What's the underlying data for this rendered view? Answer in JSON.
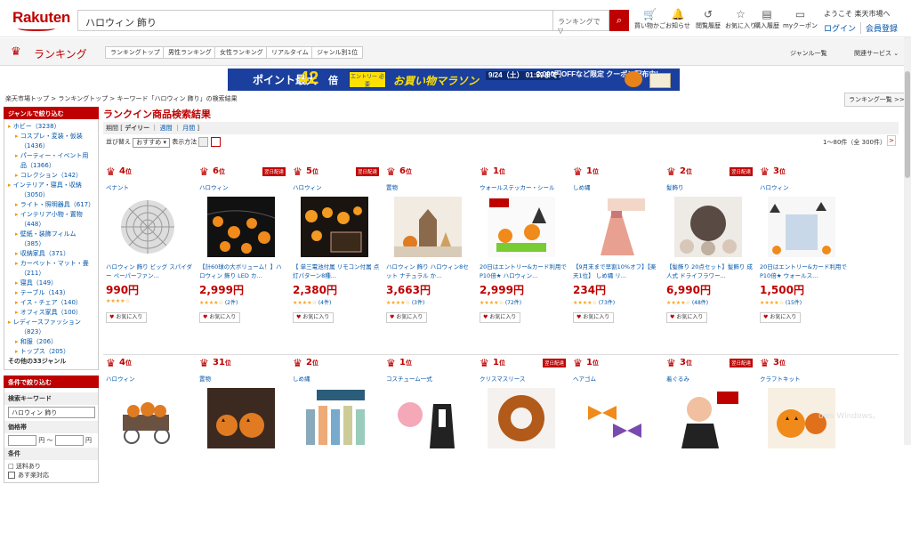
{
  "header": {
    "logo": "Rakuten",
    "search_value": "ハロウィン 飾り",
    "search_scope": "ランキングで ▽",
    "search_icon": "search-icon",
    "nav": [
      {
        "label": "買い物かご",
        "icon": "cart-icon",
        "glyph": "🛒"
      },
      {
        "label": "お知らせ",
        "icon": "notification-icon",
        "glyph": "🔔"
      },
      {
        "label": "閲覧履歴",
        "icon": "history-icon",
        "glyph": "↺"
      },
      {
        "label": "お気に入り",
        "icon": "star-icon",
        "glyph": "☆"
      },
      {
        "label": "購入履歴",
        "icon": "purchase-icon",
        "glyph": "▤"
      },
      {
        "label": "myクーポン",
        "icon": "coupon-icon",
        "glyph": "▭"
      }
    ],
    "welcome": "ようこそ 楽天市場へ",
    "login": "ログイン",
    "member": "会員登録"
  },
  "rankbar": {
    "title": "ランキング",
    "tabs": [
      "ランキングトップ",
      "男性ランキング",
      "女性ランキング",
      "リアルタイム",
      "ジャンル別1位"
    ],
    "genre_list": "ジャンル一覧",
    "related": "関連サービス ⌄"
  },
  "banner": {
    "point": "ポイント最大",
    "big": "42",
    "bai": "倍",
    "entry": "エントリー 必要",
    "marathon": "お買い物マラソン",
    "date": "9/24（土） 01:59まで",
    "coupon": "2,000円OFFなど限定 クーポン配布中!"
  },
  "breadcrumb": {
    "a": "楽天市場トップ",
    "b": "ランキングトップ",
    "c": "キーワード「ハロウィン 飾り」の検索結果",
    "sep": " > "
  },
  "rank_all": "ランキング一覧 >>",
  "sidebar": {
    "genre_h": "ジャンルで絞り込む",
    "items": [
      {
        "t": "ホビー（3238）",
        "lv": 0
      },
      {
        "t": "コスプレ・変装・仮装",
        "lv": 1
      },
      {
        "t": "（1436）",
        "lv": 2
      },
      {
        "t": "パーティー・イベント用",
        "lv": 1
      },
      {
        "t": "品（1366）",
        "lv": 2
      },
      {
        "t": "コレクション（142）",
        "lv": 1
      },
      {
        "t": "インテリア・寝具・収納",
        "lv": 0
      },
      {
        "t": "（3050）",
        "lv": 2
      },
      {
        "t": "ライト・照明器具（617）",
        "lv": 1
      },
      {
        "t": "インテリア小物・置物",
        "lv": 1
      },
      {
        "t": "（448）",
        "lv": 2
      },
      {
        "t": "壁紙・装飾フィルム",
        "lv": 1
      },
      {
        "t": "（385）",
        "lv": 2
      },
      {
        "t": "収納家具（371）",
        "lv": 1
      },
      {
        "t": "カーペット・マット・畳",
        "lv": 1
      },
      {
        "t": "（211）",
        "lv": 2
      },
      {
        "t": "寝具（149）",
        "lv": 1
      },
      {
        "t": "テーブル（143）",
        "lv": 1
      },
      {
        "t": "イス・チェア（140）",
        "lv": 1
      },
      {
        "t": "オフィス家具（100）",
        "lv": 1
      },
      {
        "t": "レディースファッション",
        "lv": 0
      },
      {
        "t": "（823）",
        "lv": 2
      },
      {
        "t": "和服（206）",
        "lv": 1
      },
      {
        "t": "トップス（205）",
        "lv": 1
      }
    ],
    "more": "その他の33ジャンル",
    "cond_h": "条件で絞り込む",
    "kw_label": "検索キーワード",
    "kw_value": "ハロウィン 飾り",
    "price_label": "価格帯",
    "yen1": "円 ～",
    "yen2": "円",
    "cond_label": "条件",
    "c1": "□ 送料あり",
    "c2": "あす楽対応"
  },
  "main": {
    "title": "ランクイン商品検索結果",
    "period_label": "期間",
    "daily": "デイリー",
    "weekly": "週間",
    "monthly": "月間",
    "sort_label": "並び替え",
    "sort_value": "おすすめ ▾",
    "view_label": "表示方法",
    "count": "1〜80件（全 300件）",
    "next": ">",
    "fav": "お気に入り",
    "fav_icon": "heart-icon",
    "same_day": "翌日配達"
  },
  "row1": [
    {
      "rank": "4",
      "genre": "ペナント",
      "name": "ハロウィン 飾り ビッグ スパイダー ペーパーファン...",
      "price": "990円",
      "reviews": "",
      "ship": false,
      "thumb": "web"
    },
    {
      "rank": "6",
      "genre": "ハロウィン",
      "name": "【計60球の大ボリューム！】ハロウィン 飾り LED カ...",
      "price": "2,999円",
      "reviews": "(2件)",
      "ship": true,
      "thumb": "pumpkins"
    },
    {
      "rank": "5",
      "genre": "ハロウィン",
      "name": "【 単三電池付属 リモコン付属 点灯パターン8種...",
      "price": "2,380円",
      "reviews": "(4件)",
      "ship": true,
      "thumb": "lights"
    },
    {
      "rank": "6",
      "genre": "置物",
      "name": "ハロウィン 飾り ハロウィン8セット ナチュラル か...",
      "price": "3,663円",
      "reviews": "(3件)",
      "ship": false,
      "thumb": "house"
    },
    {
      "rank": "1",
      "genre": "ウォールステッカー・シール",
      "name": "20日はエントリー&カード利用でP10倍★ ハロウィン...",
      "price": "2,999円",
      "reviews": "(72件)",
      "ship": false,
      "thumb": "sticker"
    },
    {
      "rank": "1",
      "genre": "しめ縄",
      "name": "【9月末まで早割10%オフ】【楽天1位】 しめ縄 リ...",
      "price": "234円",
      "reviews": "(73件)",
      "ship": false,
      "thumb": "tassel"
    },
    {
      "rank": "2",
      "genre": "髪飾り",
      "name": "【髪飾り 20点セット】髪飾り 成人式 ドライフラワー...",
      "price": "6,990円",
      "reviews": "(48件)",
      "ship": true,
      "thumb": "flowers"
    },
    {
      "rank": "3",
      "genre": "ハロウィン",
      "name": "20日はエントリー&カード利用でP10倍★ ウォールス...",
      "price": "1,500円",
      "reviews": "(15件)",
      "ship": false,
      "thumb": "wall"
    }
  ],
  "row2": [
    {
      "rank": "4",
      "genre": "ハロウィン",
      "thumb": "cart",
      "ship": false
    },
    {
      "rank": "31",
      "genre": "置物",
      "thumb": "jacks",
      "ship": false
    },
    {
      "rank": "2",
      "genre": "しめ縄",
      "thumb": "shimenawa",
      "ship": false
    },
    {
      "rank": "1",
      "genre": "コスチューム一式",
      "thumb": "cosplay",
      "ship": false
    },
    {
      "rank": "1",
      "genre": "クリスマスリース",
      "thumb": "wreath",
      "ship": true
    },
    {
      "rank": "1",
      "genre": "ヘアゴム",
      "thumb": "bows",
      "ship": false
    },
    {
      "rank": "3",
      "genre": "着ぐるみ",
      "thumb": "costume",
      "ship": true
    },
    {
      "rank": "3",
      "genre": "クラフトキット",
      "thumb": "craft",
      "ship": false
    }
  ],
  "watermark": "ows Windows。",
  "colors": {
    "brand": "#bf0000",
    "link": "#0055aa",
    "banner": "#1a3f9e"
  }
}
